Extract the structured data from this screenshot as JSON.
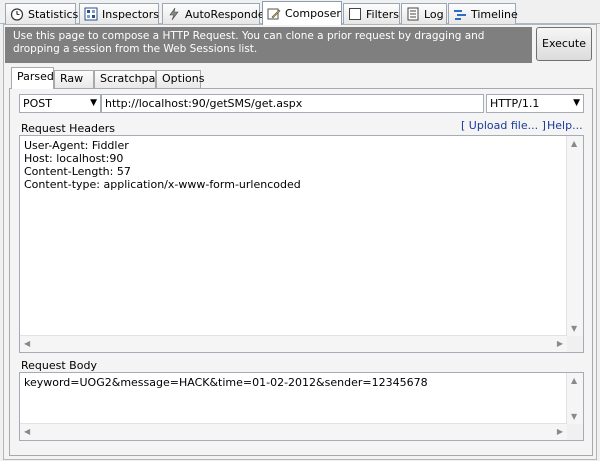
{
  "main_tabs": [
    {
      "label": "Statistics",
      "icon": "stopwatch-icon"
    },
    {
      "label": "Inspectors",
      "icon": "inspectors-icon"
    },
    {
      "label": "AutoResponder",
      "icon": "lightning-icon"
    },
    {
      "label": "Composer",
      "icon": "composer-pencil-icon",
      "active": true
    },
    {
      "label": "Filters",
      "icon": "checkbox-icon"
    },
    {
      "label": "Log",
      "icon": "log-icon"
    },
    {
      "label": "Timeline",
      "icon": "timeline-icon"
    }
  ],
  "info_text": "Use this page to compose a HTTP Request. You can clone a prior request by dragging and dropping a session from the Web Sessions list.",
  "execute_label": "Execute",
  "sub_tabs": [
    "Parsed",
    "Raw",
    "Scratchpad",
    "Options"
  ],
  "request": {
    "method": "POST",
    "url": "http://localhost:90/getSMS/get.aspx",
    "version": "HTTP/1.1"
  },
  "headers_label": "Request Headers",
  "upload_link": "[ Upload file... ]",
  "help_link": "Help...",
  "headers_text": "User-Agent: Fiddler\nHost: localhost:90\nContent-Length: 57\nContent-type: application/x-www-form-urlencoded",
  "body_label": "Request Body",
  "body_text": "keyword=UOG2&message=HACK&time=01-02-2012&sender=12345678"
}
